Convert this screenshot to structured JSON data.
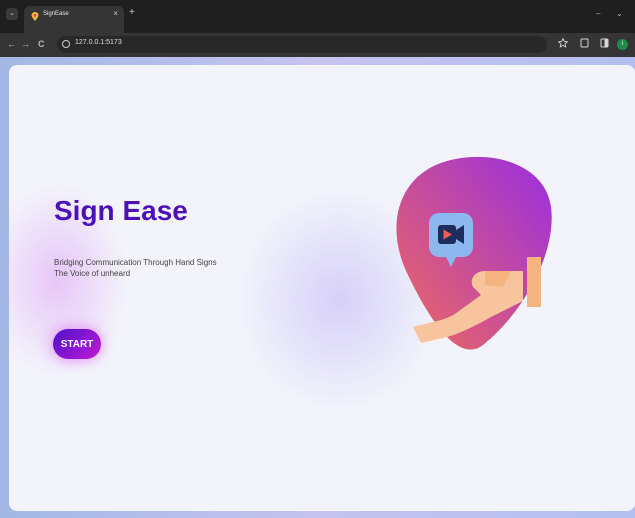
{
  "browser": {
    "tab": {
      "title": "SignEase",
      "close_glyph": "×",
      "favicon": "pin-favicon-icon"
    },
    "new_tab_glyph": "+",
    "tab_menu_glyph": "⌄",
    "minimize_glyph": "–",
    "window_menu_glyph": "⌄",
    "nav": {
      "back_glyph": "←",
      "forward_glyph": "→",
      "reload_glyph": "C"
    },
    "url": "127.0.0.1:5173",
    "toolbar_icons": [
      "star-icon",
      "extensions-icon",
      "sidepanel-icon"
    ],
    "profile_initial": "i",
    "profile_color": "#1f8a4c"
  },
  "hero": {
    "title": "Sign Ease",
    "tagline_line1": "Bridging Communication Through Hand Signs",
    "tagline_line2": "The Voice of unheard",
    "start_label": "START",
    "title_color": "#4b11b6",
    "button_gradient": [
      "#4c11c9",
      "#c31ad6"
    ],
    "blob_gradient": [
      "#9a2ee0",
      "#e85a6e"
    ]
  }
}
